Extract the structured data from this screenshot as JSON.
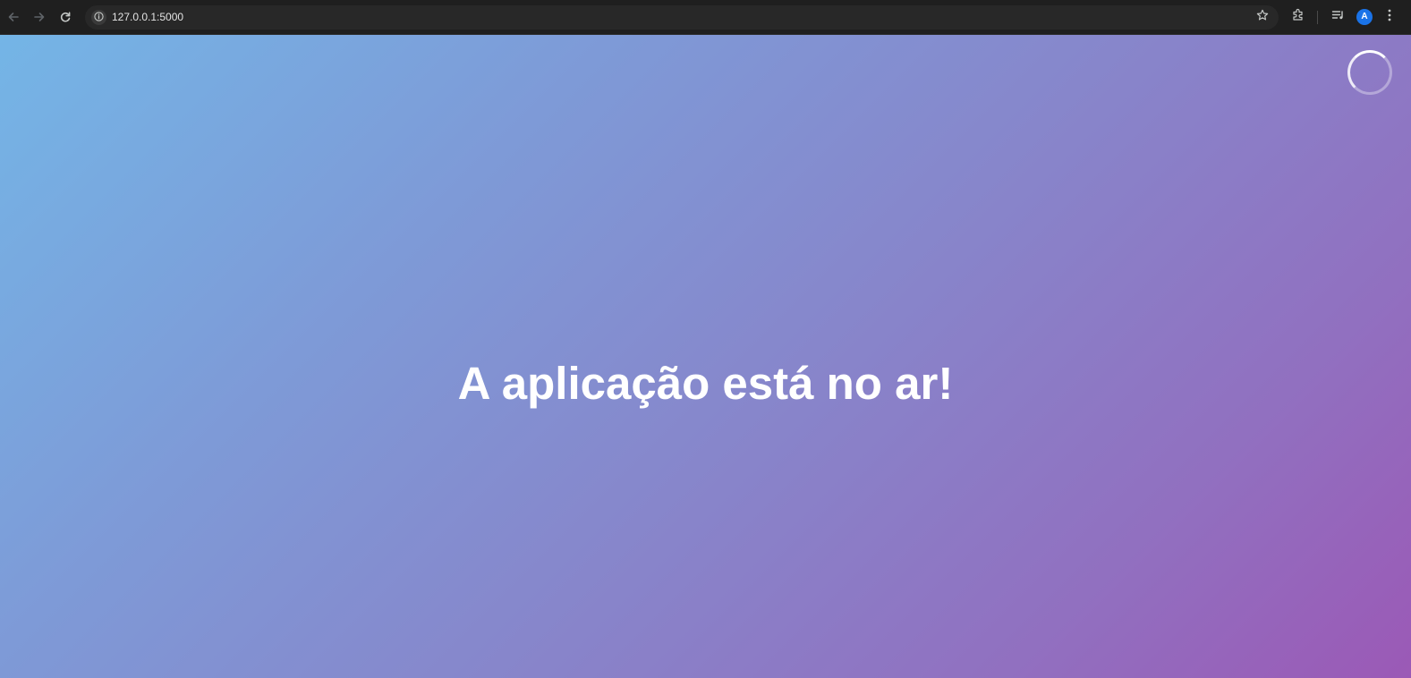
{
  "browser": {
    "url": "127.0.0.1:5000",
    "profile_initial": "A",
    "icons": {
      "back": "arrow-left-icon",
      "forward": "arrow-right-icon",
      "reload": "reload-icon",
      "site_info": "info-icon",
      "bookmark": "star-icon",
      "extensions": "puzzle-icon",
      "media": "playlist-icon",
      "menu": "kebab-menu-icon"
    }
  },
  "page": {
    "headline": "A aplicação está no ar!",
    "loading_indicator": "spinner-icon",
    "background_gradient": [
      "#74b5e6",
      "#9b59b6"
    ],
    "text_color": "#ffffff"
  }
}
